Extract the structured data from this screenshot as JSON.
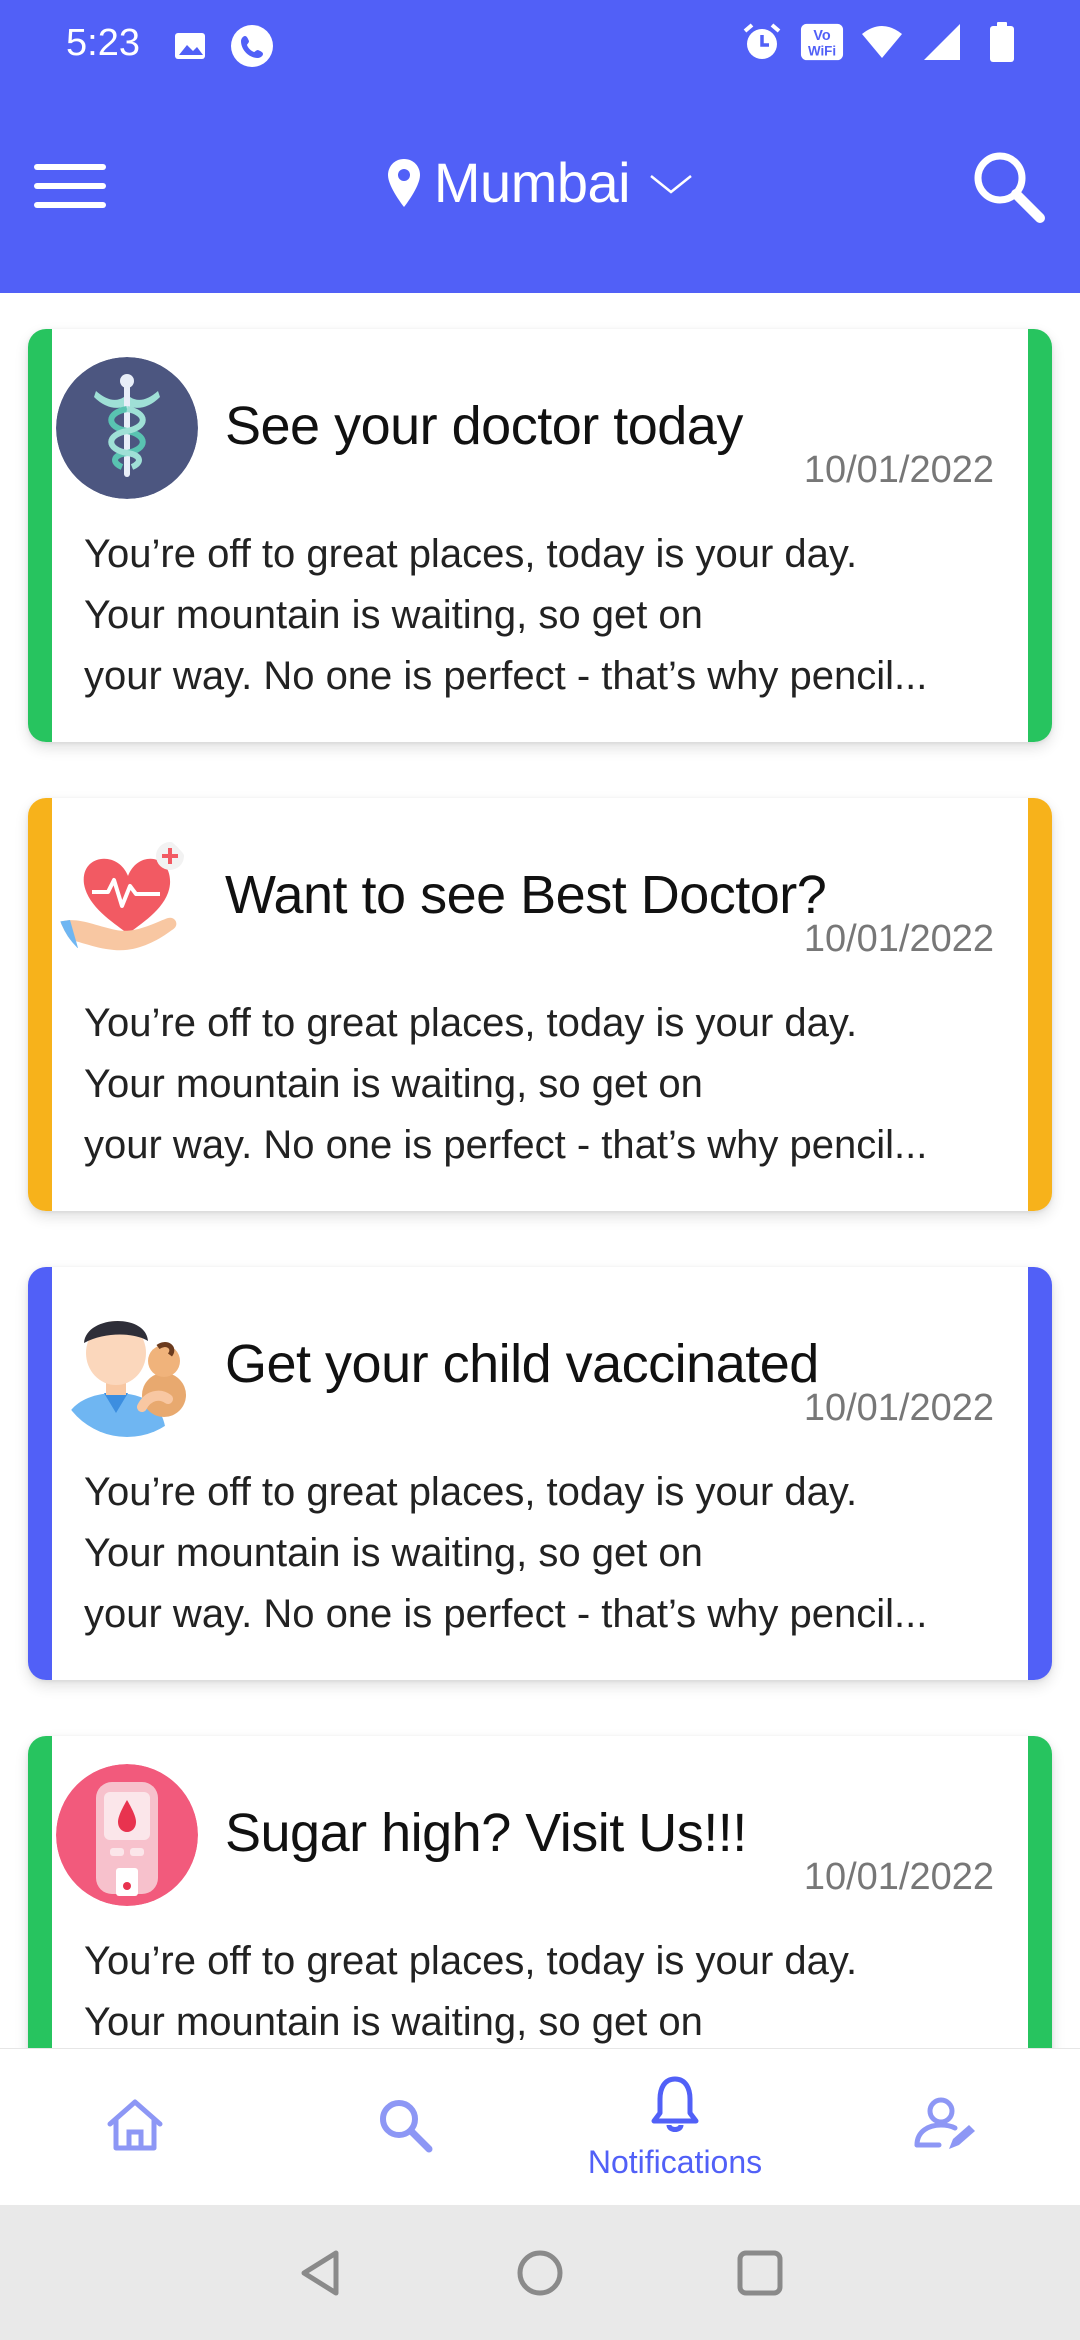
{
  "status_bar": {
    "time": "5:23",
    "icons": [
      "image-icon",
      "phone-icon",
      "alarm-icon",
      "vowifi-icon",
      "wifi-icon",
      "signal-icon",
      "battery-icon"
    ],
    "vowifi_text": "Vo WiFi"
  },
  "app_bar": {
    "location": "Mumbai",
    "menu_icon": "menu-icon",
    "search_icon": "search-icon",
    "color": "#5160f7"
  },
  "cards": [
    {
      "title": "See your doctor today",
      "date": "10/01/2022",
      "accent": "#27c45f",
      "icon": "caduceus-icon",
      "lines": [
        "You’re off to great places, today is your day.",
        "Your mountain is waiting, so get on",
        "your way. No one is perfect - that’s why pencil..."
      ]
    },
    {
      "title": "Want to see Best Doctor?",
      "date": "10/01/2022",
      "accent": "#f7b21b",
      "icon": "heart-hand-icon",
      "lines": [
        "You’re off to great places, today is your day.",
        "Your mountain is waiting, so get on",
        "your way. No one is perfect - that’s why pencil..."
      ]
    },
    {
      "title": "Get your child vaccinated",
      "date": "10/01/2022",
      "accent": "#5160f7",
      "icon": "parent-child-icon",
      "lines": [
        "You’re off to great places, today is your day.",
        "Your mountain is waiting, so get on",
        "your way. No one is perfect - that’s why pencil..."
      ]
    },
    {
      "title": "Sugar high? Visit Us!!!",
      "date": "10/01/2022",
      "accent": "#27c45f",
      "icon": "glucometer-icon",
      "lines": [
        "You’re off to great places, today is your day.",
        "Your mountain is waiting, so get on"
      ]
    }
  ],
  "bottom_nav": {
    "items": [
      {
        "icon": "home-icon",
        "label": ""
      },
      {
        "icon": "search-icon",
        "label": ""
      },
      {
        "icon": "bell-icon",
        "label": "Notifications",
        "active": true
      },
      {
        "icon": "profile-edit-icon",
        "label": ""
      }
    ]
  },
  "system_nav": [
    "back-icon",
    "home-circle-icon",
    "recents-icon"
  ]
}
